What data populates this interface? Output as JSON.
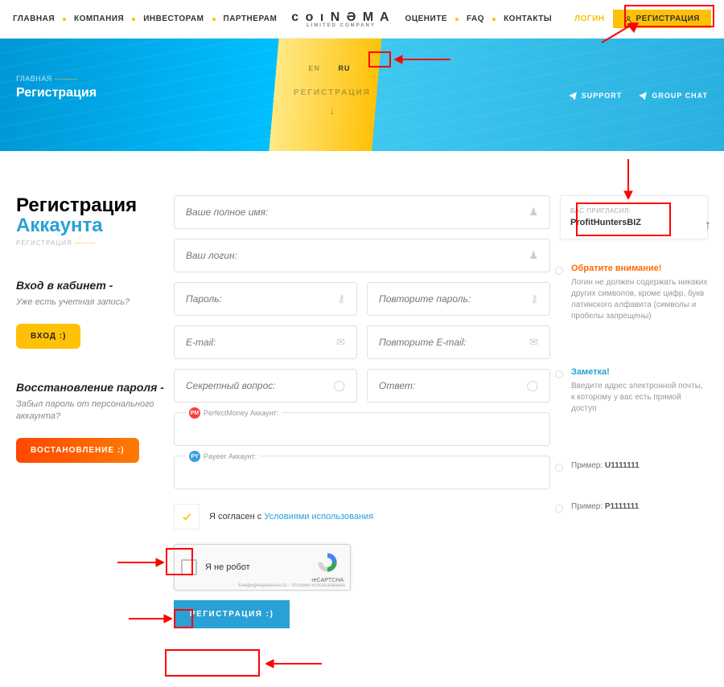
{
  "nav": {
    "left": [
      "ГЛАВНАЯ",
      "КОМПАНИЯ",
      "ИНВЕСТОРАМ",
      "ПАРТНЕРАМ"
    ],
    "logo": "c o ı N Ə M A",
    "logo_sub": "LIMITED COMPANY",
    "right": [
      "ОЦЕНИТЕ",
      "FAQ",
      "КОНТАКТЫ"
    ],
    "login": "ЛОГИН",
    "register": "РЕГИСТРАЦИЯ"
  },
  "hero": {
    "crumb": "ГЛАВНАЯ",
    "title": "Регистрация",
    "lang_en": "EN",
    "lang_ru": "RU",
    "mid_title": "РЕГИСТРАЦИЯ",
    "support": "SUPPORT",
    "group": "GROUP CHAT"
  },
  "left": {
    "h1a": "Регистрация",
    "h1b": "Аккаунта",
    "crumb2": "РЕГИСТРАЦИЯ",
    "block1_h": "Вход в кабинет -",
    "block1_p": "Уже есть учетная запись?",
    "block1_btn": "ВХОД  :)",
    "block2_h": "Восстановление пароля -",
    "block2_p": "Забыл пароль от персонального аккаунта?",
    "block2_btn": "ВОСТАНОВЛЕНИЕ  :)"
  },
  "form": {
    "fullname_ph": "Ваше полное имя:",
    "login_ph": "Ваш логин:",
    "password_ph": "Пароль:",
    "password2_ph": "Повторите пароль:",
    "email_ph": "E-mail:",
    "email2_ph": "Повторите E-mail:",
    "question_ph": "Секретный вопрос:",
    "answer_ph": "Ответ:",
    "pm_label": "PerfectMoney Аккаунт:",
    "payeer_label": "Payeer Аккаунт:",
    "terms_prefix": "Я согласен с ",
    "terms_link": "Условиями использования",
    "captcha": "Я не робот",
    "captcha_logo": "reCAPTCHA",
    "captcha_foot": "Конфиденциальность - Условия использования",
    "submit": "РЕГИСТРАЦИЯ  :)"
  },
  "right": {
    "invited_label": "ВАС ПРИГЛАСИЛ:",
    "invited_value": "ProfitHuntersBIZ",
    "attn_h": "Обратите внимание!",
    "attn_p": "Логин не должен содержать никаких других символов, кроме цифр, букв латинского алфавита (символы и пробелы запрещены)",
    "note_h": "Заметка!",
    "note_p": "Введите адрес электронной почты, к которому у вас есть прямой доступ",
    "hint1_pre": "Пример: ",
    "hint1_val": "U1111111",
    "hint2_pre": "Пример: ",
    "hint2_val": "P1111111"
  }
}
